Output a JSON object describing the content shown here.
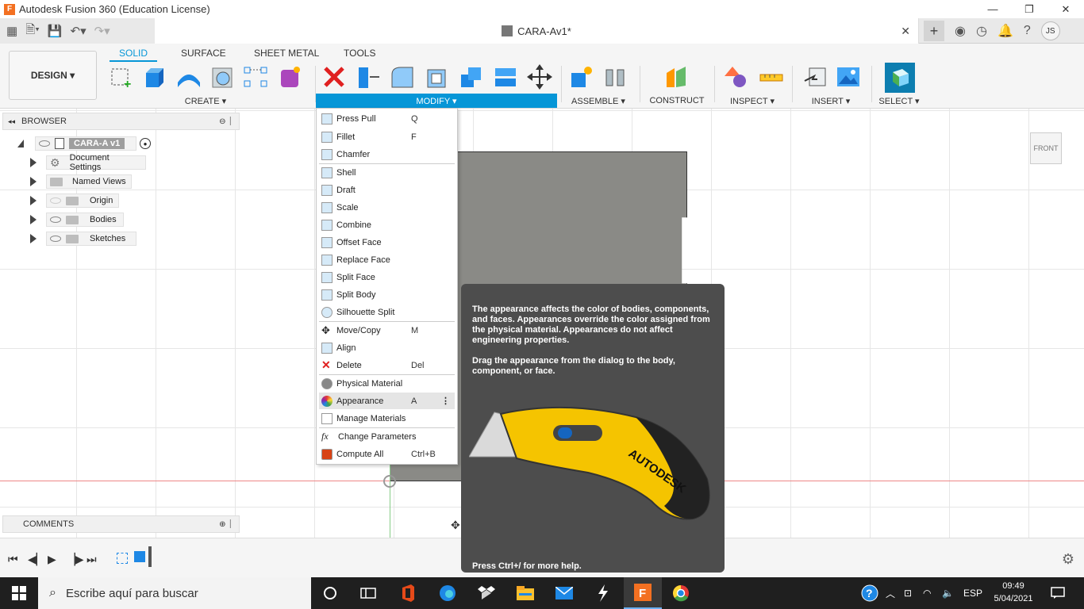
{
  "window": {
    "title": "Autodesk Fusion 360 (Education License)",
    "logo_letter": "F",
    "minimize": "—",
    "restore": "❐",
    "close": "✕"
  },
  "appbar": {
    "doc_title": "CARA-Av1*",
    "close_tab": "✕",
    "new_tab": "+",
    "user_initials": "JS"
  },
  "toolbar": {
    "workspace": "DESIGN ▾",
    "tabs": [
      "SOLID",
      "SURFACE",
      "SHEET METAL",
      "TOOLS"
    ],
    "groups": {
      "create": "CREATE ▾",
      "modify": "MODIFY ▾",
      "assemble": "ASSEMBLE ▾",
      "construct": "CONSTRUCT ▾",
      "inspect": "INSPECT ▾",
      "insert": "INSERT ▾",
      "select": "SELECT ▾"
    }
  },
  "browser": {
    "title": "BROWSER",
    "root": "CARA-A v1",
    "items": [
      "Document Settings",
      "Named Views",
      "Origin",
      "Bodies",
      "Sketches"
    ]
  },
  "comments": {
    "title": "COMMENTS"
  },
  "viewcube": {
    "label": "FRONT"
  },
  "modify_menu": {
    "items": [
      {
        "label": "Press Pull",
        "shortcut": "Q"
      },
      {
        "label": "Fillet",
        "shortcut": "F"
      },
      {
        "label": "Chamfer",
        "shortcut": ""
      },
      {
        "label": "Shell",
        "shortcut": ""
      },
      {
        "label": "Draft",
        "shortcut": ""
      },
      {
        "label": "Scale",
        "shortcut": ""
      },
      {
        "label": "Combine",
        "shortcut": ""
      },
      {
        "label": "Offset Face",
        "shortcut": ""
      },
      {
        "label": "Replace Face",
        "shortcut": ""
      },
      {
        "label": "Split Face",
        "shortcut": ""
      },
      {
        "label": "Split Body",
        "shortcut": ""
      },
      {
        "label": "Silhouette Split",
        "shortcut": ""
      },
      {
        "label": "Move/Copy",
        "shortcut": "M"
      },
      {
        "label": "Align",
        "shortcut": ""
      },
      {
        "label": "Delete",
        "shortcut": "Del"
      },
      {
        "label": "Physical Material",
        "shortcut": ""
      },
      {
        "label": "Appearance",
        "shortcut": "A"
      },
      {
        "label": "Manage Materials",
        "shortcut": ""
      },
      {
        "label": "Change Parameters",
        "shortcut": ""
      },
      {
        "label": "Compute All",
        "shortcut": "Ctrl+B"
      }
    ]
  },
  "tooltip": {
    "para1": "The appearance affects the color of bodies, components, and faces. Appearances override the color assigned from the physical material. Appearances do not affect engineering properties.",
    "para2": "Drag the appearance from the dialog to the body, component, or face.",
    "footer": "Press Ctrl+/ for more help.",
    "image_brand": "AUTODESK"
  },
  "taskbar": {
    "search_placeholder": "Escribe aquí para buscar",
    "language": "ESP",
    "time": "09:49",
    "date": "5/04/2021"
  },
  "colors": {
    "accent": "#0696d7",
    "delete_red": "#e02020",
    "tooltip_bg": "#4d4d4d"
  }
}
